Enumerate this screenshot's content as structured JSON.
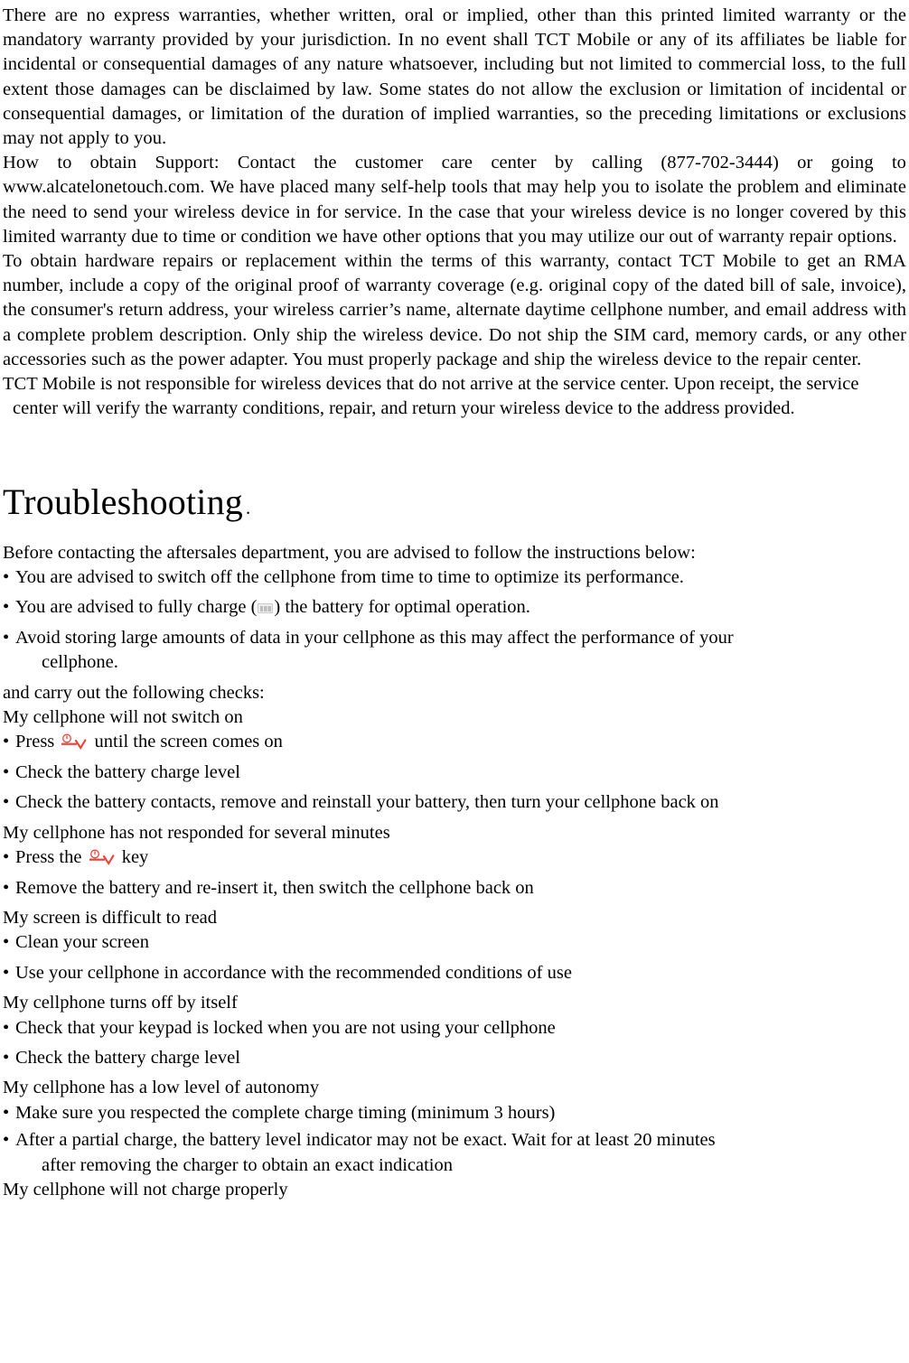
{
  "document": {
    "warranty": {
      "paragraphs": [
        "There are no express warranties, whether written, oral or implied, other than this printed limited warranty or the mandatory warranty provided by your jurisdiction. In no event shall TCT Mobile or any of its affiliates be liable for incidental or consequential damages of any nature whatsoever, including but not limited to commercial loss, to the full extent those damages can be disclaimed by law. Some states do not allow the exclusion or limitation of incidental or consequential damages, or limitation of the duration of implied warranties, so the preceding limitations or exclusions may not apply to you.",
        "How to obtain Support: Contact the customer care center by calling (877-702-3444) or going to www.alcatelonetouch.com. We have placed many self-help tools that may help you to isolate the problem and eliminate the need to send your wireless device in for service. In the case that your wireless device is no longer covered by this limited warranty due to time or condition we have other options that you may utilize our out of warranty repair options.",
        "To obtain hardware repairs or replacement within the terms of this warranty, contact TCT Mobile to get an RMA number, include a copy of the original proof of warranty coverage (e.g. original copy of the dated bill of sale, invoice), the consumer's return address, your wireless carrier’s name, alternate daytime cellphone number, and email address with a complete problem description. Only ship the wireless device. Do not ship the SIM card, memory cards, or any other accessories such as the power adapter. You must properly package and ship the wireless device to the repair center."
      ],
      "hanging_paragraph": "TCT Mobile is not responsible for wireless devices that do not arrive at the service center. Upon receipt, the service center will verify the warranty conditions, repair, and return your wireless device to the address provided."
    },
    "troubleshooting": {
      "heading": "Troubleshooting",
      "heading_suffix": ".",
      "intro": "Before contacting the aftersales department, you are advised to follow the instructions below:",
      "intro_bullets": [
        "You are advised to switch off the cellphone from time to time to optimize its performance.",
        {
          "pre": "You are advised to fully charge (",
          "icon": "battery-icon",
          "post": ") the battery for optimal operation."
        },
        "Avoid storing large amounts of data in your cellphone as this may affect the performance of your"
      ],
      "intro_bullet_continuation": "cellphone.",
      "checks_line": "and carry out the following checks:",
      "sections": [
        {
          "title": "My cellphone will not switch on",
          "items": [
            {
              "pre": "Press ",
              "icon": "power-key-icon",
              "post": " until the screen comes on"
            },
            "Check the battery charge level",
            "Check the battery contacts, remove and reinstall your battery, then turn your cellphone back on"
          ]
        },
        {
          "title": "My cellphone has not responded for several minutes",
          "items": [
            {
              "pre": "Press the ",
              "icon": "power-key-icon",
              "post": " key"
            },
            "Remove the battery and re-insert it, then switch the cellphone back on"
          ]
        },
        {
          "title": "My screen is difficult to read",
          "items": [
            "Clean your screen",
            "Use your cellphone in accordance with the recommended conditions of use"
          ]
        },
        {
          "title": "My cellphone turns off by itself",
          "items": [
            "Check that your keypad is locked when you are not using your cellphone",
            "Check the battery charge level"
          ]
        },
        {
          "title": "My cellphone has a low level of autonomy",
          "items": [
            "Make sure you respected the complete charge timing (minimum 3 hours)",
            "After a partial charge, the battery level indicator may not be exact. Wait for at least 20 minutes"
          ],
          "item_continuation": "after removing the charger to obtain an exact indication"
        },
        {
          "title": "My cellphone will not charge properly",
          "items": []
        }
      ]
    },
    "bullet_glyph": "•",
    "colors": {
      "text": "#000000",
      "page_background": "#ffffff",
      "power_key_accent": "#e8463c",
      "battery_icon_fill": "#bdbdbd"
    }
  }
}
